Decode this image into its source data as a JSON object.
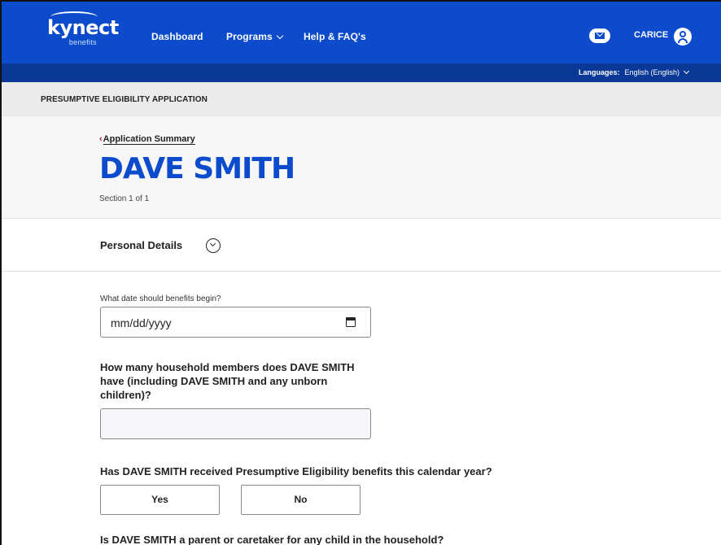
{
  "brand": {
    "name": "kynect",
    "sub": "benefits"
  },
  "nav": {
    "dashboard": "Dashboard",
    "programs": "Programs",
    "help": "Help & FAQ's",
    "mail_icon": "mail-icon",
    "user_name": "CARICE",
    "user_icon": "user-avatar-icon"
  },
  "languages": {
    "label": "Languages:",
    "value": "English (English)"
  },
  "application": {
    "title": "PRESUMPTIVE ELIGIBILITY APPLICATION"
  },
  "header": {
    "back_arrow": "‹",
    "back_link": "Application Summary",
    "person_name": "DAVE SMITH",
    "section": "Section 1 of 1"
  },
  "personal_details": {
    "title": "Personal Details"
  },
  "form": {
    "q1_label": "What date should benefits begin?",
    "q1_placeholder": "mm/dd/yyyy",
    "q2_label": "How many household members does DAVE SMITH have (including DAVE SMITH and any unborn children)?",
    "q2_value": "",
    "q3_label": "Has DAVE SMITH received Presumptive Eligibility benefits this calendar year?",
    "q3_yes": "Yes",
    "q3_no": "No",
    "q4_label": "Is DAVE SMITH a parent or caretaker for any child in the household?"
  },
  "colors": {
    "primary": "#0b4bcc",
    "nav_dark": "#0a3896",
    "accent": "#c4124f"
  }
}
